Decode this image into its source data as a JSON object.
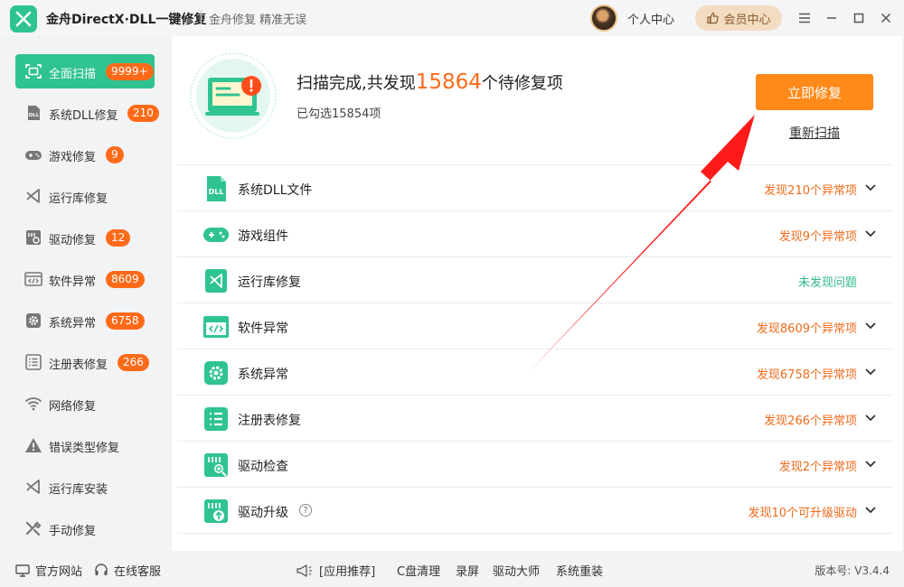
{
  "app": {
    "title": "金舟DirectX·DLL一键修复",
    "slogan": "金舟修复 精准无误",
    "user_center": "个人中心",
    "vip": "会员中心"
  },
  "sidebar": {
    "items": [
      {
        "label": "全面扫描",
        "badge": "9999+",
        "icon": "scan-icon",
        "active": true
      },
      {
        "label": "系统DLL修复",
        "badge": "210",
        "icon": "dll-icon"
      },
      {
        "label": "游戏修复",
        "badge": "9",
        "icon": "gamepad-icon"
      },
      {
        "label": "运行库修复",
        "badge": "",
        "icon": "runtime-icon"
      },
      {
        "label": "驱动修复",
        "badge": "12",
        "icon": "driver-icon"
      },
      {
        "label": "软件异常",
        "badge": "8609",
        "icon": "code-window-icon"
      },
      {
        "label": "系统异常",
        "badge": "6758",
        "icon": "gear-icon"
      },
      {
        "label": "注册表修复",
        "badge": "266",
        "icon": "list-icon"
      },
      {
        "label": "网络修复",
        "badge": "",
        "icon": "wifi-icon"
      },
      {
        "label": "错误类型修复",
        "badge": "",
        "icon": "warning-icon"
      },
      {
        "label": "运行库安装",
        "badge": "",
        "icon": "runtime-install-icon"
      },
      {
        "label": "手动修复",
        "badge": "",
        "icon": "tools-icon"
      }
    ]
  },
  "scan": {
    "headline_prefix": "扫描完成,共发现",
    "count": "15864",
    "headline_suffix": "个待修复项",
    "selected": "已勾选15854项",
    "fix_button": "立即修复",
    "rescan": "重新扫描"
  },
  "results": [
    {
      "name": "系统DLL文件",
      "status": "发现210个异常项",
      "ok": false,
      "icon": "dll-file-icon"
    },
    {
      "name": "游戏组件",
      "status": "发现9个异常项",
      "ok": false,
      "icon": "gamepad-icon"
    },
    {
      "name": "运行库修复",
      "status": "未发现问题",
      "ok": true,
      "icon": "runtime-icon"
    },
    {
      "name": "软件异常",
      "status": "发现8609个异常项",
      "ok": false,
      "icon": "code-window-icon"
    },
    {
      "name": "系统异常",
      "status": "发现6758个异常项",
      "ok": false,
      "icon": "gear-icon"
    },
    {
      "name": "注册表修复",
      "status": "发现266个异常项",
      "ok": false,
      "icon": "list-icon"
    },
    {
      "name": "驱动检查",
      "status": "发现2个异常项",
      "ok": false,
      "icon": "driver-check-icon"
    },
    {
      "name": "驱动升级",
      "status": "发现10个可升级驱动",
      "ok": false,
      "icon": "driver-upgrade-icon",
      "help": "?"
    }
  ],
  "footer": {
    "website": "官方网站",
    "service": "在线客服",
    "recommend": "[应用推荐]",
    "links": [
      "C盘清理",
      "录屏",
      "驱动大师",
      "系统重装"
    ],
    "version": "版本号: V3.4.4"
  },
  "colors": {
    "brand_green": "#2fc392",
    "accent_orange": "#ff6a19",
    "button_orange": "#ff8a1a",
    "arrow_red": "#ff1a1a"
  }
}
